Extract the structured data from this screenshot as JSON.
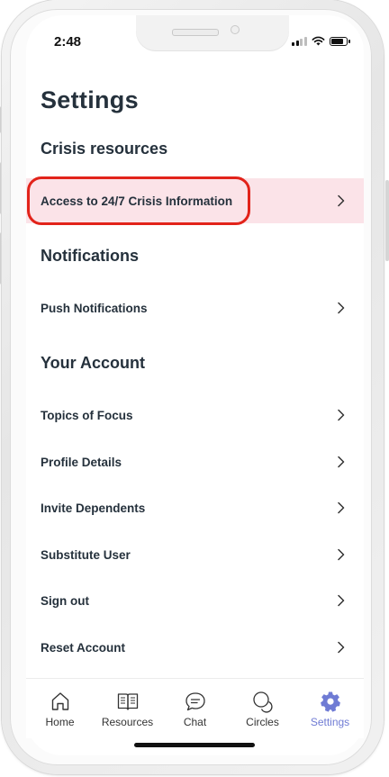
{
  "status_bar": {
    "time": "2:48"
  },
  "page": {
    "title": "Settings"
  },
  "sections": [
    {
      "title": "Crisis resources",
      "items": [
        {
          "label": "Access to 24/7 Crisis Information",
          "icon": "chevron-right-icon"
        }
      ]
    },
    {
      "title": "Notifications",
      "items": [
        {
          "label": "Push Notifications",
          "icon": "chevron-right-icon"
        }
      ]
    },
    {
      "title": "Your Account",
      "items": [
        {
          "label": "Topics of Focus",
          "icon": "chevron-right-icon"
        },
        {
          "label": "Profile Details",
          "icon": "chevron-right-icon"
        },
        {
          "label": "Invite Dependents",
          "icon": "chevron-right-icon"
        },
        {
          "label": "Substitute User",
          "icon": "chevron-right-icon"
        },
        {
          "label": "Sign out",
          "icon": "chevron-right-icon"
        },
        {
          "label": "Reset Account",
          "icon": "chevron-right-icon"
        }
      ]
    }
  ],
  "tab_bar": {
    "items": [
      {
        "label": "Home",
        "icon": "home-icon"
      },
      {
        "label": "Resources",
        "icon": "book-icon"
      },
      {
        "label": "Chat",
        "icon": "chat-bubble-icon"
      },
      {
        "label": "Circles",
        "icon": "circles-icon"
      },
      {
        "label": "Settings",
        "icon": "gear-icon"
      }
    ],
    "active": "Settings"
  },
  "colors": {
    "highlight_row": "#fbe3e8",
    "annotation_outline": "#e2231a",
    "active_tab": "#6f7bd4",
    "text": "#25313c"
  }
}
